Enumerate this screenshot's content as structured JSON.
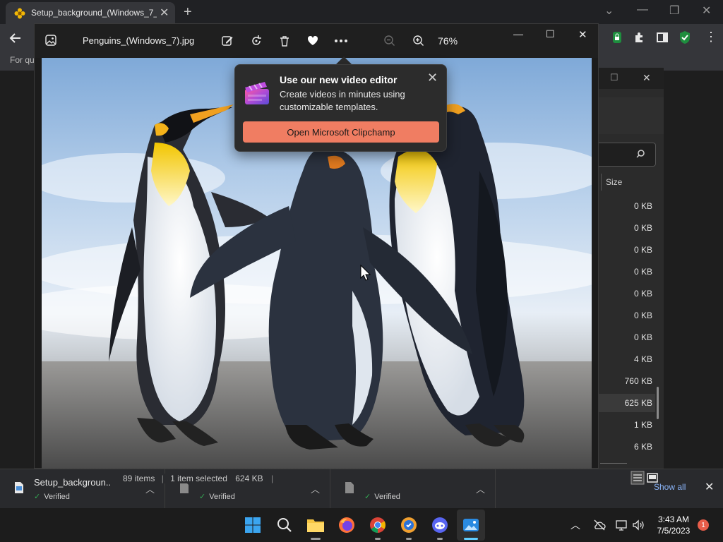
{
  "browser": {
    "tab_title": "Setup_background_(Windows_7_",
    "bookmarks_text": "For qu"
  },
  "explorer": {
    "size_header": "Size",
    "sizes": [
      "0 KB",
      "0 KB",
      "0 KB",
      "0 KB",
      "0 KB",
      "0 KB",
      "0 KB",
      "4 KB",
      "760 KB",
      "625 KB",
      "1 KB",
      "6 KB"
    ],
    "status": {
      "items": "89 items",
      "selected": "1 item selected",
      "size": "624 KB"
    }
  },
  "photos": {
    "file_name": "Penguins_(Windows_7).jpg",
    "zoom": "76%",
    "toolbar_icons": [
      "edit-image-icon",
      "rotate-icon",
      "delete-icon",
      "favorite-heart-icon",
      "more-options-icon",
      "zoom-out-icon",
      "zoom-in-icon"
    ]
  },
  "popup": {
    "title": "Use our new video editor",
    "body": "Create videos in minutes using customizable templates.",
    "button": "Open Microsoft Clipchamp"
  },
  "downloads": {
    "items": [
      {
        "name": "Setup_backgroun...",
        "status": "Verified"
      },
      {
        "name": "",
        "status": "Verified"
      },
      {
        "name": "",
        "status": "Verified"
      }
    ],
    "show_all": "Show all"
  },
  "taskbar": {
    "time": "3:43 AM",
    "date": "7/5/2023",
    "notifications": "1"
  },
  "colors": {
    "accent_button": "#f07d62",
    "verified_green": "#34a853",
    "link_blue": "#8ab4f8",
    "badge_red": "#e85d4a"
  }
}
